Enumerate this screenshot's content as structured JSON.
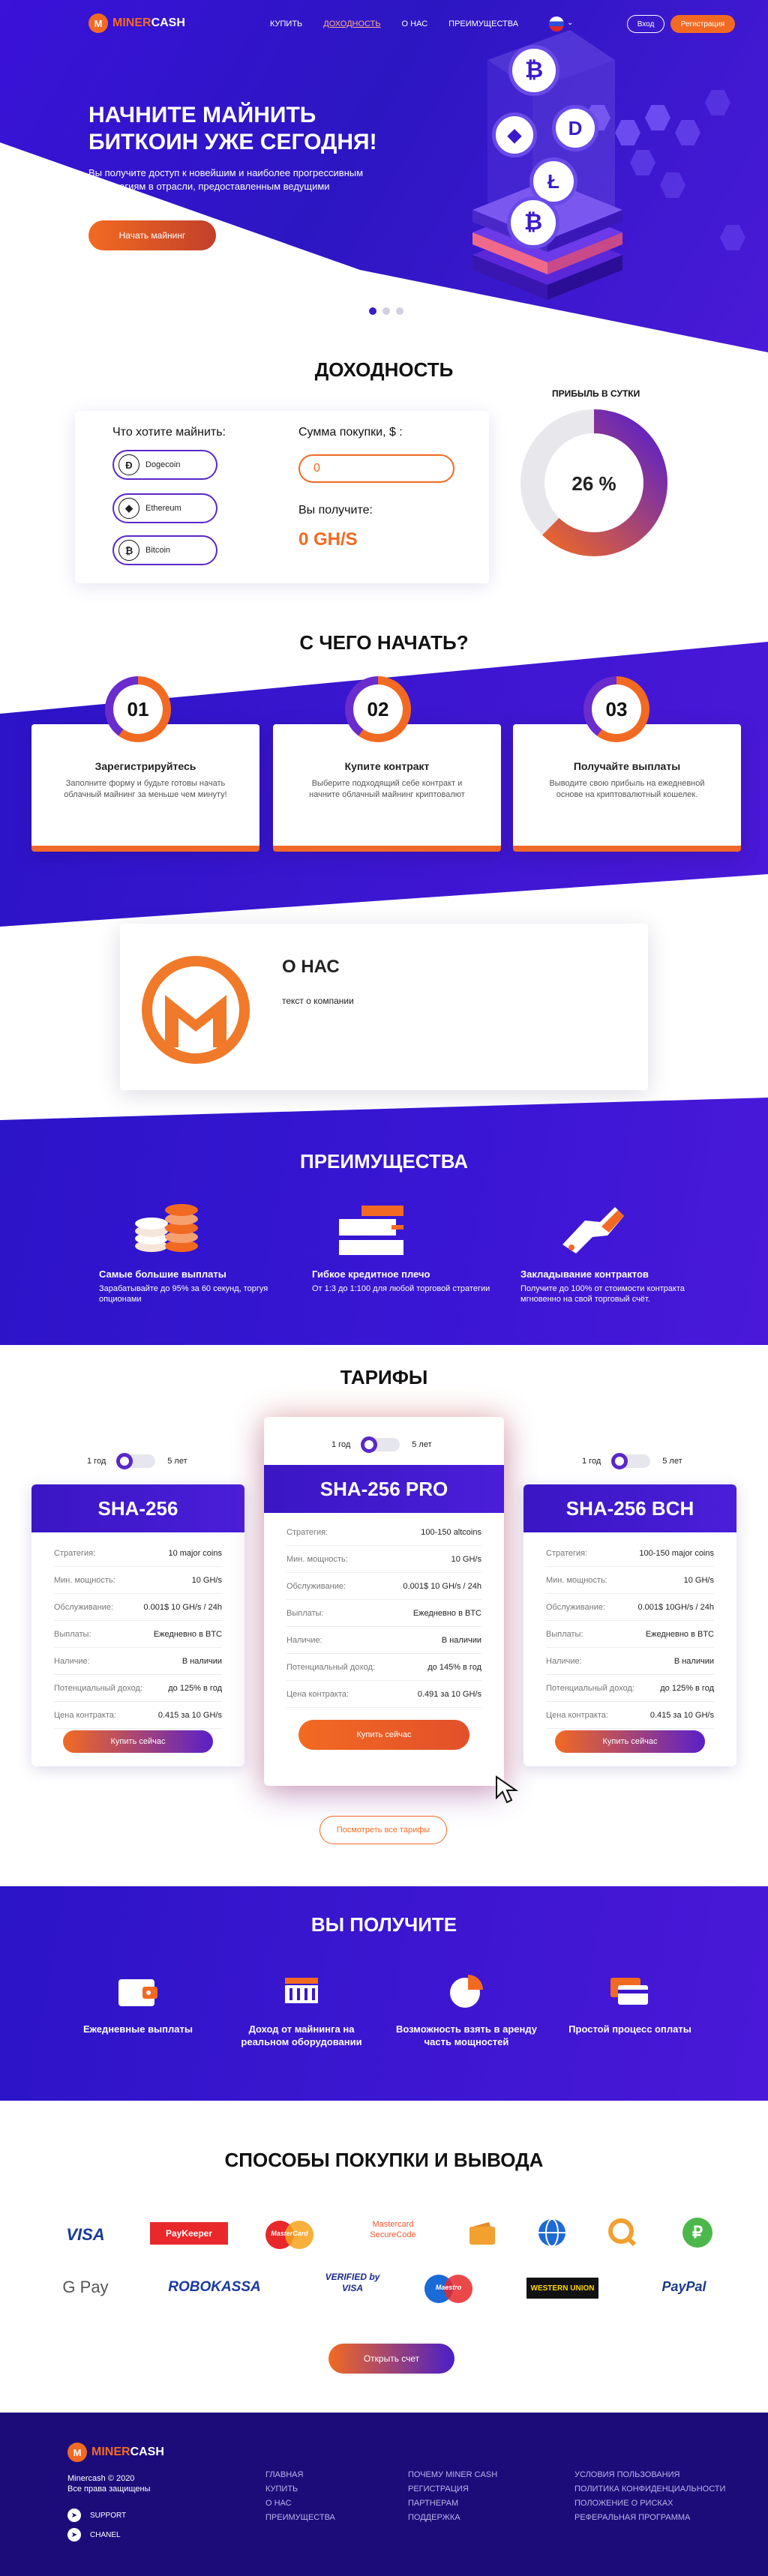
{
  "nav": {
    "brand_a": "MINER",
    "brand_b": "CASH",
    "items": [
      "КУПИТЬ",
      "ДОХОДНОСТЬ",
      "О НАС",
      "ПРЕИМУЩЕСТВА"
    ],
    "login": "Вход",
    "register": "Регистрация"
  },
  "hero": {
    "title": "НАЧНИТЕ МАЙНИТЬ БИТКОИН УЖЕ СЕГОДНЯ!",
    "text": "Вы получите доступ к новейшим и наиболее прогрессивным технологиям в отрасли, предоставленным ведущими компаниями.",
    "button": "Начать майнинг"
  },
  "profit": {
    "title": "ДОХОДНОСТЬ",
    "what_label": "Что хотите майнить:",
    "algos": [
      "Dogecoin",
      "Ethereum",
      "Bitcoin"
    ],
    "sum_label": "Сумма покупки, $ :",
    "sum_value": "0",
    "receive_label": "Вы получите:",
    "receive_value": "0 GH/S",
    "daily_label": "ПРИБЫЛЬ В СУТКИ",
    "daily_percent": "26 %",
    "daily_fraction": 0.26
  },
  "start": {
    "title": "С ЧЕГО НАЧАТЬ?",
    "steps": [
      {
        "num": "01",
        "title": "Зарегистрируйтесь",
        "text": "Заполните форму и будьте готовы начать облачный майнинг за меньше чем минуту!"
      },
      {
        "num": "02",
        "title": "Купите контракт",
        "text": "Выберите подходящий себе контракт и начните облачный майнинг криптовалют"
      },
      {
        "num": "03",
        "title": "Получайте выплаты",
        "text": "Выводите свою прибыль на ежедневной основе на криптовалютный кошелек."
      }
    ]
  },
  "about": {
    "title": "О НАС",
    "text": "текст о компании"
  },
  "advantages": {
    "title": "ПРЕИМУЩЕСТВА",
    "items": [
      {
        "title": "Самые большие выплаты",
        "text": "Зарабатывайте до 95% за 60 секунд, торгуя опционами"
      },
      {
        "title": "Гибкое кредитное плечо",
        "text": "От 1:3 до 1:100 для любой торговой стратегии"
      },
      {
        "title": "Закладывание контрактов",
        "text": "Получите до 100% от стоимости контракта мгновенно на свой торговый счёт."
      }
    ]
  },
  "tariffs": {
    "title": "ТАРИФЫ",
    "term_a": "1 год",
    "term_b": "5 лет",
    "buy": "Купить сейчас",
    "all": "Посмотреть все тарифы",
    "plans": [
      {
        "name": "SHA-256",
        "rows": [
          [
            "Стратегия:",
            "10 major coins"
          ],
          [
            "Мин. мощность:",
            "10 GH/s"
          ],
          [
            "Обслуживание:",
            "0.001$  10 GH/s / 24h"
          ],
          [
            "Выплаты:",
            "Ежедневно в BTC"
          ],
          [
            "Наличие:",
            "В наличии"
          ],
          [
            "Потенциальный доход:",
            "до  125% в год"
          ],
          [
            "Цена контракта:",
            "0.415 за 10 GH/s"
          ]
        ]
      },
      {
        "name": "SHA-256 PRO",
        "rows": [
          [
            "Стратегия:",
            "100-150 altcoins"
          ],
          [
            "Мин. мощность:",
            "10 GH/s"
          ],
          [
            "Обслуживание:",
            "0.001$  10 GH/s / 24h"
          ],
          [
            "Выплаты:",
            "Ежедневно в BTC"
          ],
          [
            "Наличие:",
            "В наличии"
          ],
          [
            "Потенциальный доход:",
            "до  145% в год"
          ],
          [
            "Цена контракта:",
            "0.491 за 10 GH/s"
          ]
        ]
      },
      {
        "name": "SHA-256 BCH",
        "rows": [
          [
            "Стратегия:",
            "100-150 major coins"
          ],
          [
            "Мин. мощность:",
            "10 GH/s"
          ],
          [
            "Обслуживание:",
            "0.001$  10GH/s / 24h"
          ],
          [
            "Выплаты:",
            "Ежедневно в BTC"
          ],
          [
            "Наличие:",
            "В наличии"
          ],
          [
            "Потенциальный доход:",
            "до  125% в год"
          ],
          [
            "Цена контракта:",
            "0.415 за 10 GH/s"
          ]
        ]
      }
    ]
  },
  "receive": {
    "title": "ВЫ ПОЛУЧИТЕ",
    "items": [
      "Ежедневные выплаты",
      "Доход от майнинга на реальном оборудовании",
      "Возможность взять в аренду часть мощностей",
      "Простой процесс оплаты"
    ]
  },
  "payments": {
    "title": "СПОСОБЫ ПОКУПКИ И ВЫВОДА",
    "logos": [
      "VISA",
      "PayKeeper",
      "MasterCard",
      "Mastercard SecureCode",
      "",
      "",
      "",
      "",
      "G Pay",
      "ROBOKASSA",
      "VERIFIED by VISA",
      "Maestro",
      "WESTERN UNION",
      "PayPal"
    ],
    "button": "Открыть счет"
  },
  "footer": {
    "copy": "Minercash © 2020",
    "rights": "Все права защищены",
    "support": "SUPPORT",
    "chanel": "CHANEL",
    "col1": [
      "ГЛАВНАЯ",
      "КУПИТЬ",
      "О НАС",
      "ПРЕИМУЩЕСТВА"
    ],
    "col2": [
      "ПОЧЕМУ MINER CASH",
      "РЕГИСТРАЦИЯ",
      "ПАРТНЕРАМ",
      "ПОДДЕРЖКА"
    ],
    "col3": [
      "УСЛОВИЯ ПОЛЬЗОВАНИЯ",
      "ПОЛИТИКА КОНФИДЕНЦИАЛЬНОСТИ",
      "ПОЛОЖЕНИЕ О РИСКАХ",
      "РЕФЕРАЛЬНАЯ ПРОГРАММА"
    ]
  },
  "colors": {
    "brand": "#f26a22",
    "primary": "#3a16cc",
    "footer": "#1c0c7a"
  }
}
